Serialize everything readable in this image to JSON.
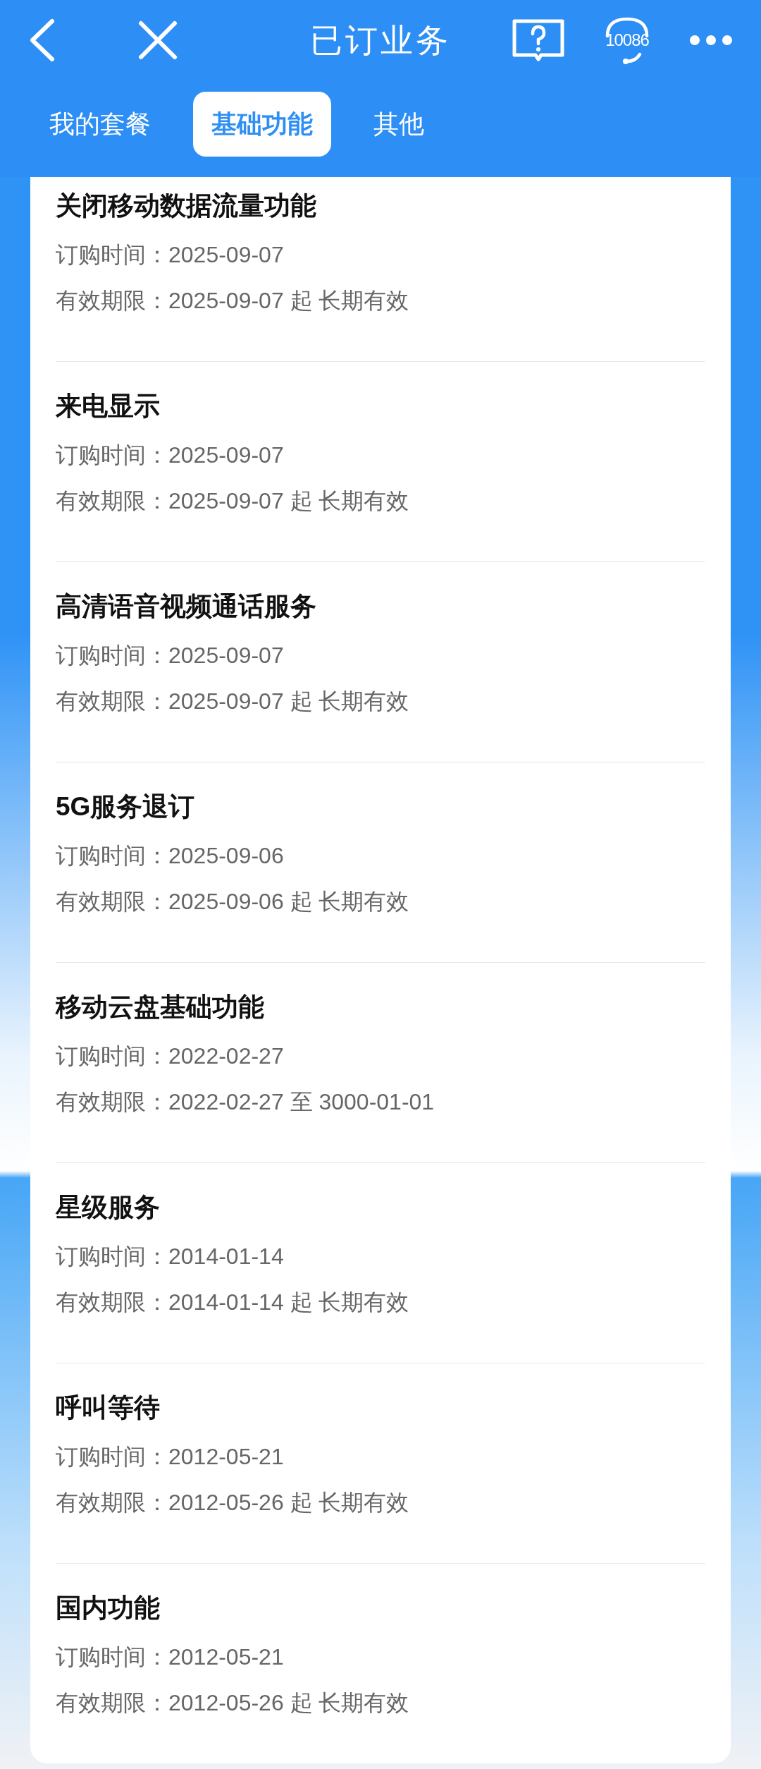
{
  "header": {
    "title": "已订业务",
    "hotline": "10086"
  },
  "tabs": [
    {
      "label": "我的套餐",
      "selected": false
    },
    {
      "label": "基础功能",
      "selected": true
    },
    {
      "label": "其他",
      "selected": false
    }
  ],
  "services": [
    {
      "name": "关闭移动数据流量功能",
      "ordered": "订购时间：2025-09-07",
      "validity": "有效期限：2025-09-07 起 长期有效"
    },
    {
      "name": "来电显示",
      "ordered": "订购时间：2025-09-07",
      "validity": "有效期限：2025-09-07 起 长期有效"
    },
    {
      "name": "高清语音视频通话服务",
      "ordered": "订购时间：2025-09-07",
      "validity": "有效期限：2025-09-07 起 长期有效"
    },
    {
      "name": "5G服务退订",
      "ordered": "订购时间：2025-09-06",
      "validity": "有效期限：2025-09-06 起 长期有效"
    },
    {
      "name": "移动云盘基础功能",
      "ordered": "订购时间：2022-02-27",
      "validity": "有效期限：2022-02-27 至 3000-01-01"
    },
    {
      "name": "星级服务",
      "ordered": "订购时间：2014-01-14",
      "validity": "有效期限：2014-01-14 起 长期有效"
    },
    {
      "name": "呼叫等待",
      "ordered": "订购时间：2012-05-21",
      "validity": "有效期限：2012-05-26 起 长期有效"
    },
    {
      "name": "国内功能",
      "ordered": "订购时间：2012-05-21",
      "validity": "有效期限：2012-05-26 起 长期有效"
    }
  ]
}
